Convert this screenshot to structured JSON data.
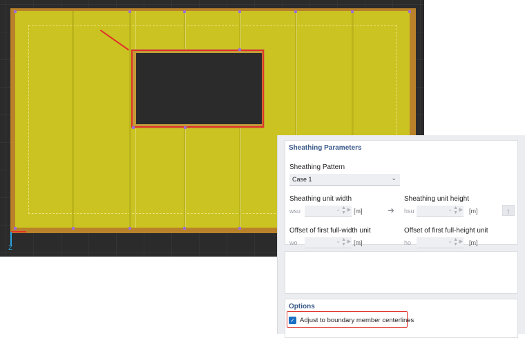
{
  "viewport": {
    "axis_label": "Z",
    "colors": {
      "panel": "#cbc321",
      "frame": "#b9822a",
      "highlight": "#e0322b",
      "background": "#2b2b2b"
    }
  },
  "sheathing": {
    "title": "Sheathing Parameters",
    "pattern_label": "Sheathing Pattern",
    "pattern_value": "Case 1",
    "unit_width_label": "Sheathing unit width",
    "unit_width_symbol": "wsu",
    "unit_width_unit": "[m]",
    "unit_height_label": "Sheathing unit height",
    "unit_height_symbol": "hsu",
    "unit_height_unit": "[m]",
    "offset_width_label": "Offset of first full-width unit",
    "offset_width_symbol": "wo",
    "offset_width_unit": "[m]",
    "offset_height_label": "Offset of first full-height unit",
    "offset_height_symbol": "ho",
    "offset_height_unit": "[m]"
  },
  "options": {
    "title": "Options",
    "adjust_label": "Adjust to boundary member centerlines",
    "adjust_checked": true
  }
}
